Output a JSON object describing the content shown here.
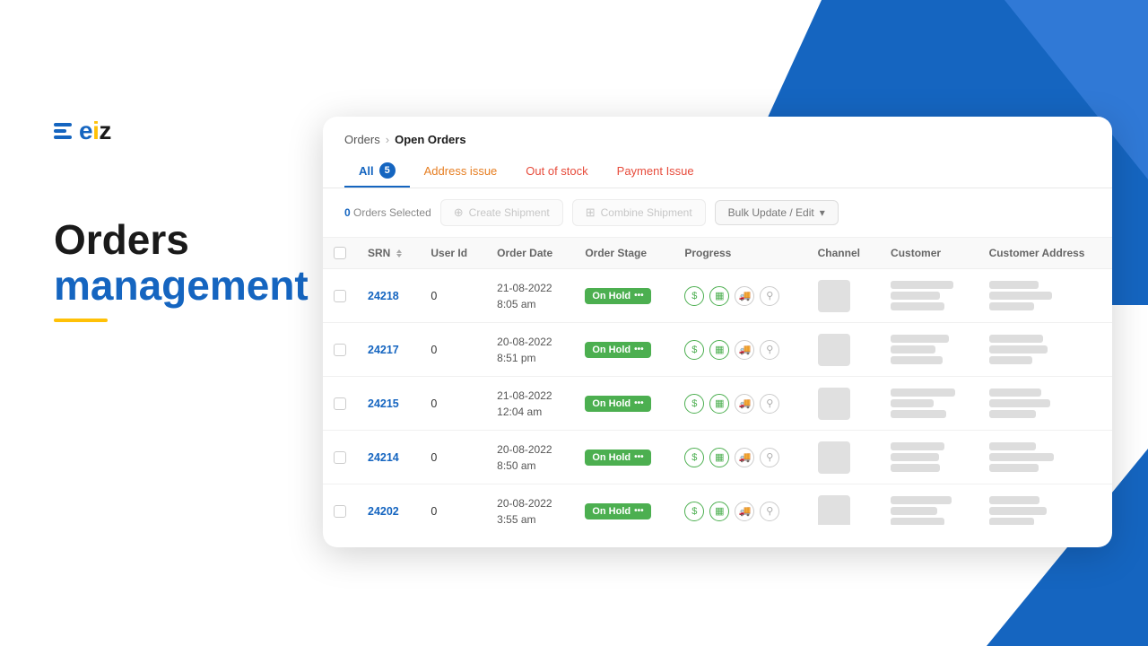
{
  "background": {
    "accent": "#1565c0",
    "yellow": "#ffc107"
  },
  "logo": {
    "icon_alt": "eiz-logo-icon",
    "text": "eiz"
  },
  "hero": {
    "line1": "Orders",
    "line2": "management"
  },
  "breadcrumb": {
    "parent": "Orders",
    "separator": "›",
    "current": "Open Orders"
  },
  "tabs": [
    {
      "id": "all",
      "label": "All",
      "badge": "5",
      "active": true
    },
    {
      "id": "address",
      "label": "Address issue",
      "active": false
    },
    {
      "id": "out-of-stock",
      "label": "Out of stock",
      "active": false
    },
    {
      "id": "payment-issue",
      "label": "Payment Issue",
      "active": false
    }
  ],
  "toolbar": {
    "selected_count": "0",
    "selected_label": "Orders Selected",
    "create_shipment": "Create Shipment",
    "combine_shipment": "Combine Shipment",
    "bulk_update": "Bulk Update / Edit"
  },
  "table": {
    "columns": [
      "SRN",
      "User Id",
      "Order Date",
      "Order Stage",
      "Progress",
      "Channel",
      "Customer",
      "Customer Address"
    ],
    "rows": [
      {
        "srn": "24218",
        "user_id": "0",
        "date": "21-08-2022",
        "time": "8:05 am",
        "stage": "On Hold"
      },
      {
        "srn": "24217",
        "user_id": "0",
        "date": "20-08-2022",
        "time": "8:51 pm",
        "stage": "On Hold"
      },
      {
        "srn": "24215",
        "user_id": "0",
        "date": "21-08-2022",
        "time": "12:04 am",
        "stage": "On Hold"
      },
      {
        "srn": "24214",
        "user_id": "0",
        "date": "20-08-2022",
        "time": "8:50 am",
        "stage": "On Hold"
      },
      {
        "srn": "24202",
        "user_id": "0",
        "date": "20-08-2022",
        "time": "3:55 am",
        "stage": "On Hold"
      }
    ]
  }
}
